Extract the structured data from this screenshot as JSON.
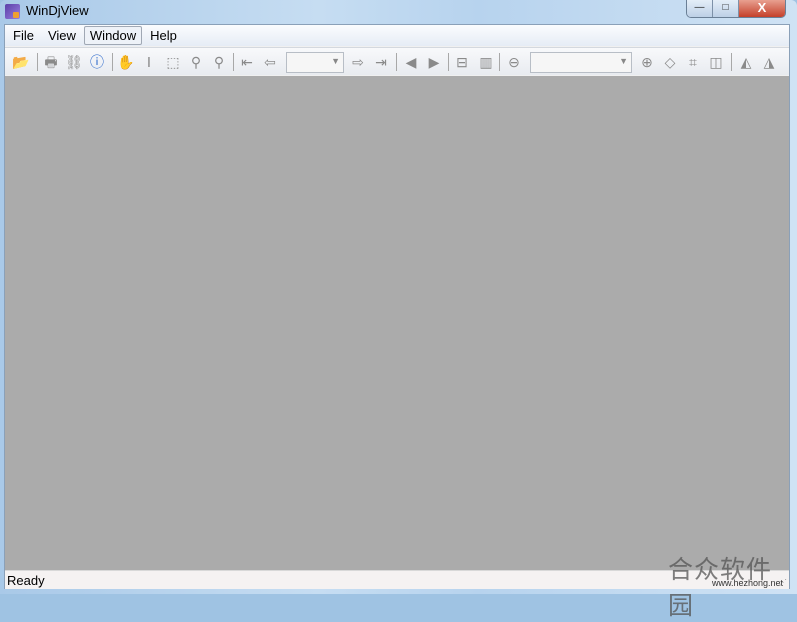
{
  "window": {
    "title": "WinDjView",
    "controls": {
      "minimize": "—",
      "maximize": "□",
      "close": "X"
    }
  },
  "menu": [
    {
      "label": "File"
    },
    {
      "label": "View"
    },
    {
      "label": "Window",
      "active": true
    },
    {
      "label": "Help"
    }
  ],
  "toolbar": {
    "page_combo": {
      "value": ""
    },
    "zoom_combo": {
      "value": ""
    }
  },
  "status": {
    "text": "Ready"
  },
  "watermark": {
    "name": "合众软件园",
    "url": "www.hezhong.net"
  },
  "colors": {
    "viewer_background": "#ababab",
    "status_bar": "#f5f2f2"
  }
}
